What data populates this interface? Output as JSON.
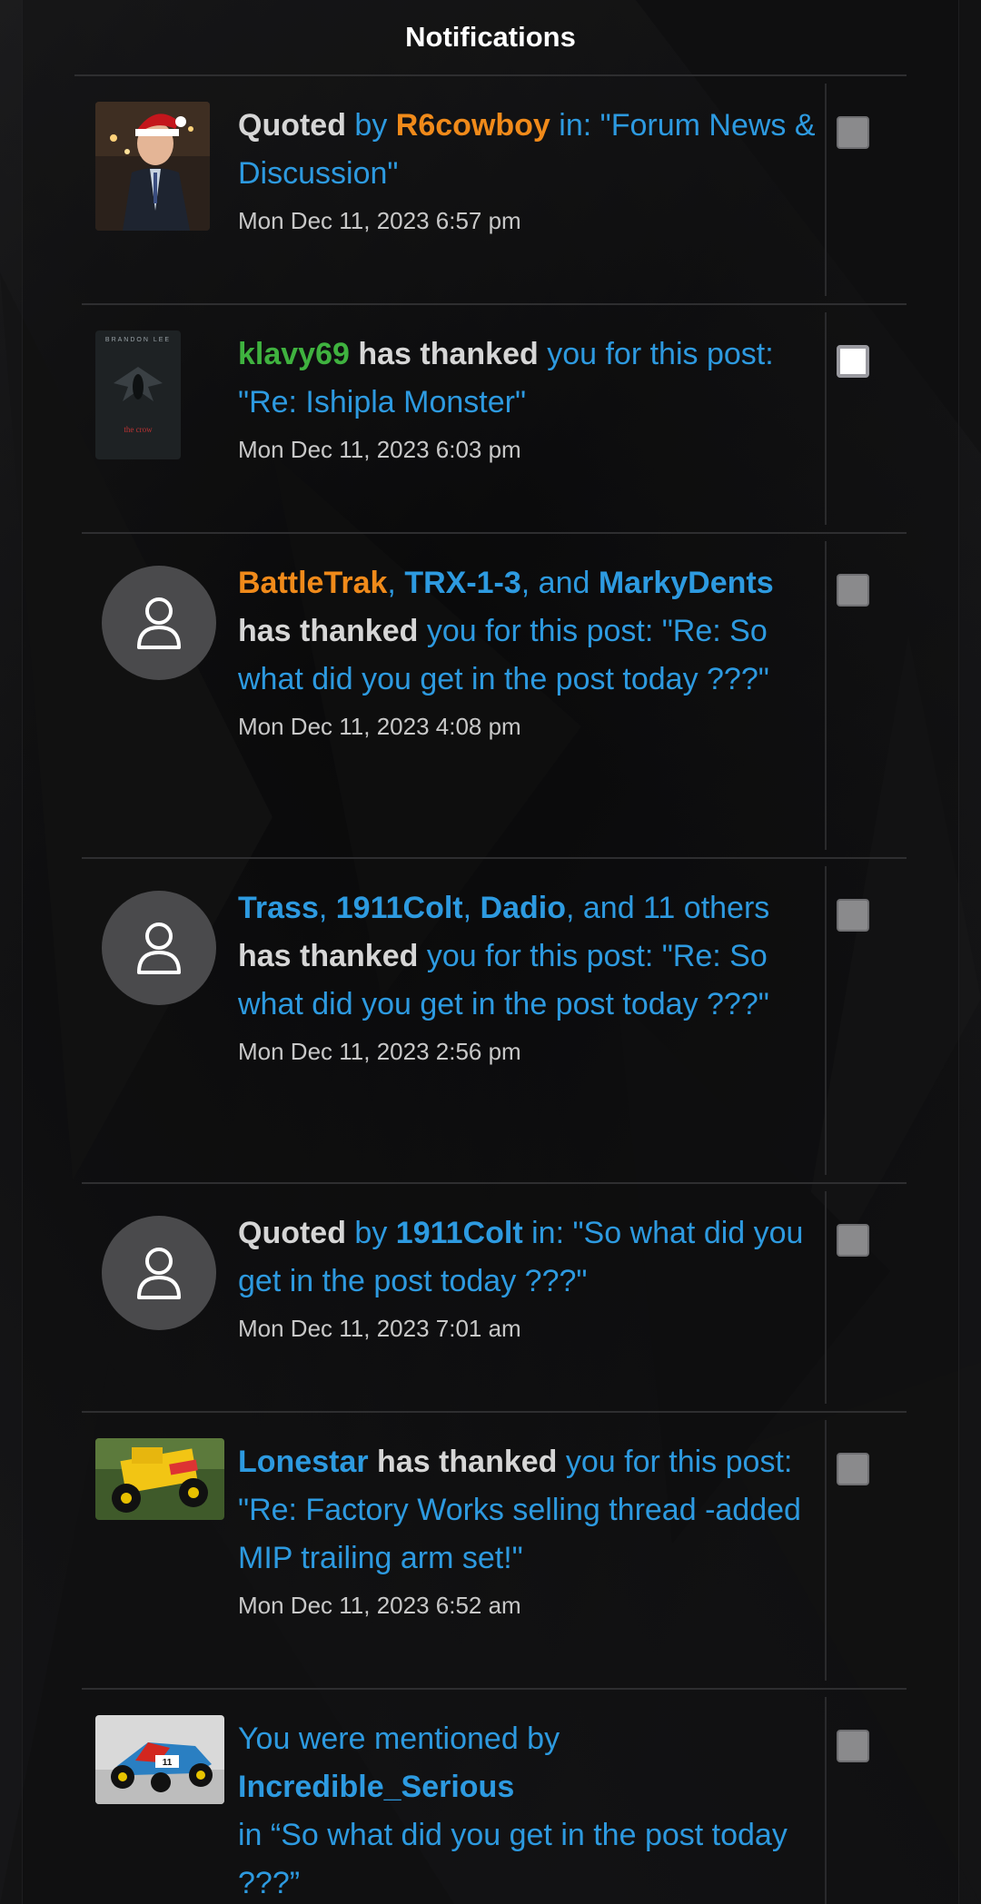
{
  "header": {
    "title": "Notifications"
  },
  "notifications": [
    {
      "parts": [
        {
          "text": "Quoted",
          "style": "strong"
        },
        {
          "text": " by ",
          "style": "link"
        },
        {
          "text": "R6cowboy",
          "style": "u-orange"
        },
        {
          "text": " in: \"Forum News & Discussion\"",
          "style": "link"
        }
      ],
      "time": "Mon Dec 11, 2023 6:57 pm",
      "avatar": "photo-santa"
    },
    {
      "parts": [
        {
          "text": "klavy69",
          "style": "u-green"
        },
        {
          "text": " ",
          "style": "link"
        },
        {
          "text": "has thanked",
          "style": "strong"
        },
        {
          "text": " you for this post: \"Re: Ishipla Monster\"",
          "style": "link"
        }
      ],
      "time": "Mon Dec 11, 2023 6:03 pm",
      "avatar": "poster-the-crow",
      "avatar_text": {
        "top": "BRANDON LEE",
        "title": "the crow"
      }
    },
    {
      "parts": [
        {
          "text": "BattleTrak",
          "style": "u-orange"
        },
        {
          "text": ", ",
          "style": "link"
        },
        {
          "text": "TRX-1-3",
          "style": "u-blue"
        },
        {
          "text": ", and ",
          "style": "link"
        },
        {
          "text": "MarkyDents",
          "style": "u-blue"
        },
        {
          "text": " ",
          "style": "link"
        },
        {
          "text": "has thanked",
          "style": "strong"
        },
        {
          "text": " you for this post: \"Re: So what did you get in the post today ???\"",
          "style": "link"
        }
      ],
      "time": "Mon Dec 11, 2023 4:08 pm",
      "avatar": "default-user-icon"
    },
    {
      "parts": [
        {
          "text": "Trass",
          "style": "u-blue"
        },
        {
          "text": ", ",
          "style": "link"
        },
        {
          "text": "1911Colt",
          "style": "u-blue"
        },
        {
          "text": ", ",
          "style": "link"
        },
        {
          "text": "Dadio",
          "style": "u-blue"
        },
        {
          "text": ", and 11 others ",
          "style": "link"
        },
        {
          "text": "has thanked",
          "style": "strong"
        },
        {
          "text": " you for this post: \"Re: So what did you get in the post today ???\"",
          "style": "link"
        }
      ],
      "time": "Mon Dec 11, 2023 2:56 pm",
      "avatar": "default-user-icon"
    },
    {
      "parts": [
        {
          "text": "Quoted",
          "style": "strong"
        },
        {
          "text": " by ",
          "style": "link"
        },
        {
          "text": "1911Colt",
          "style": "u-blue"
        },
        {
          "text": " in: \"So what did you get in the post today ???\"",
          "style": "link"
        }
      ],
      "time": "Mon Dec 11, 2023 7:01 am",
      "avatar": "default-user-icon"
    },
    {
      "parts": [
        {
          "text": "Lonestar",
          "style": "u-blue"
        },
        {
          "text": " ",
          "style": "link"
        },
        {
          "text": "has thanked",
          "style": "strong"
        },
        {
          "text": " you for this post: \"Re: Factory Works selling thread -added MIP trailing arm set!\"",
          "style": "link"
        }
      ],
      "time": "Mon Dec 11, 2023 6:52 am",
      "avatar": "photo-yellow-truck"
    },
    {
      "parts": [
        {
          "text": "You were mentioned by",
          "style": "link"
        },
        {
          "text": "Incredible_Serious",
          "style": "u-blue-block"
        },
        {
          "text": "in “So what did you get in the post today ???”",
          "style": "link-block"
        }
      ],
      "time": "",
      "avatar": "photo-rc-buggy"
    }
  ],
  "colors": {
    "link": "#2d9ae0",
    "user_orange": "#f08a1a",
    "user_green": "#3fb23f",
    "user_blue": "#2d9ae0",
    "strong_text": "#d6d6d6",
    "divider": "#2e2e30"
  }
}
